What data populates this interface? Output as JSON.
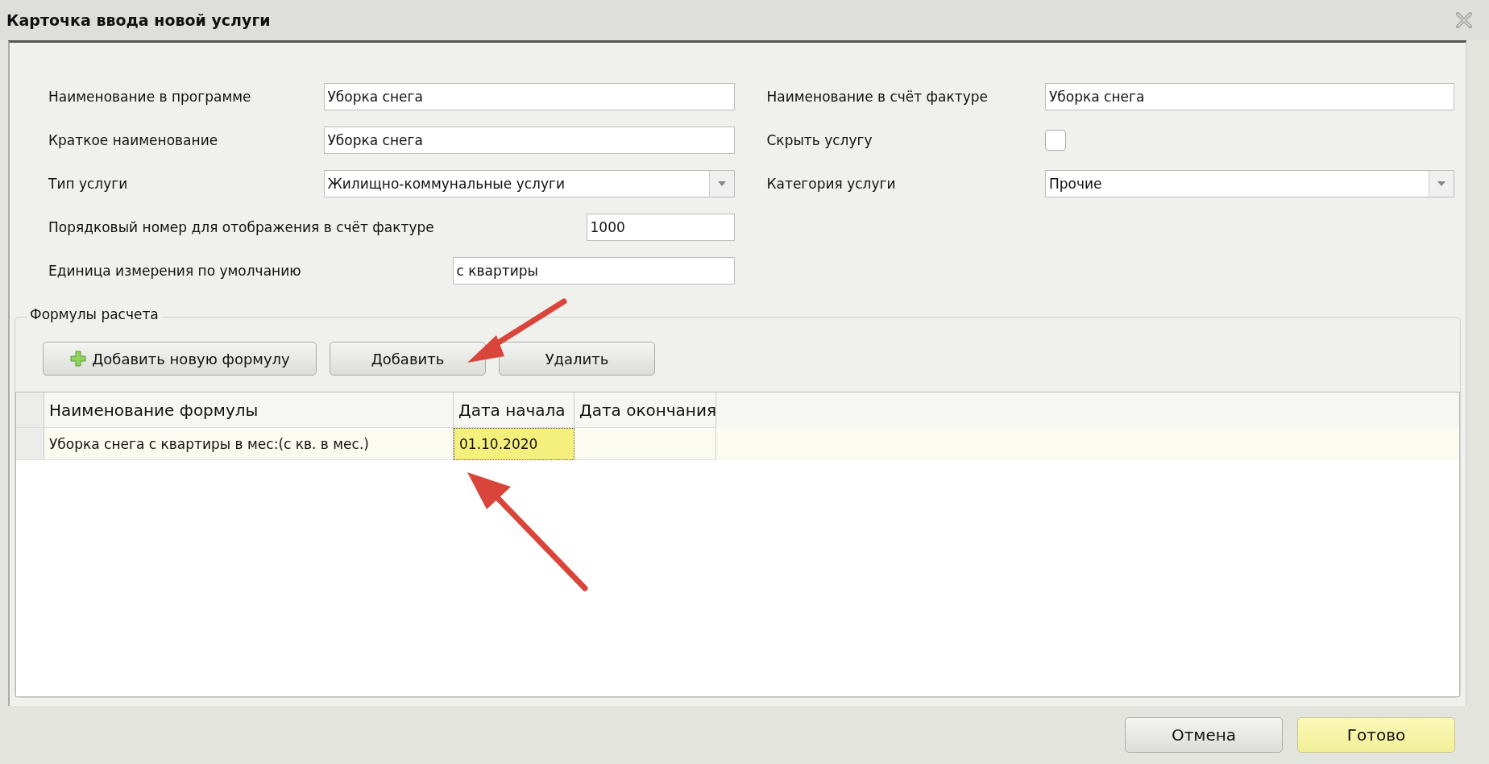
{
  "window": {
    "title": "Карточка ввода новой услуги"
  },
  "left_fields": [
    {
      "label": "Наименование в программе",
      "kind": "text",
      "value": "Уборка снега"
    },
    {
      "label": "Краткое наименование",
      "kind": "text",
      "value": "Уборка снега"
    },
    {
      "label": "Тип услуги",
      "kind": "select",
      "value": "Жилищно-коммунальные услуги"
    },
    {
      "label": "Порядковый номер для отображения в счёт фактуре",
      "kind": "text",
      "value": "1000"
    },
    {
      "label": "Единица измерения по умолчанию",
      "kind": "text",
      "value": "с квартиры"
    }
  ],
  "right_fields": [
    {
      "label": "Наименование в счёт фактуре",
      "kind": "text",
      "value": "Уборка снега"
    },
    {
      "label": "Скрыть услугу",
      "kind": "checkbox",
      "checked": false
    },
    {
      "label": "Категория услуги",
      "kind": "select",
      "value": "Прочие"
    }
  ],
  "formulas": {
    "title": "Формулы расчета",
    "buttons": [
      {
        "label": "Добавить новую формулу",
        "kind": "add"
      },
      {
        "label": "Добавить",
        "kind": "plain"
      },
      {
        "label": "Удалить",
        "kind": "plain"
      }
    ],
    "table": {
      "columns": [
        "Наименование формулы",
        "Дата начала",
        "Дата окончания"
      ],
      "rows": [
        {
          "cells": [
            {
              "text": "Уборка снега с квартиры в мес:(с кв. в мес.)",
              "focused": false
            },
            {
              "text": "01.10.2020",
              "focused": true
            }
          ]
        }
      ]
    }
  },
  "footer_buttons": [
    {
      "label": "Отмена",
      "kind": "plain"
    },
    {
      "label": "Готово",
      "kind": "primary"
    }
  ]
}
